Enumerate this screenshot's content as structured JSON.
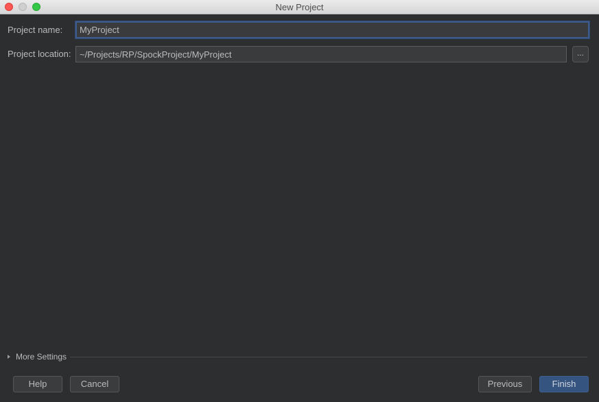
{
  "window": {
    "title": "New Project"
  },
  "form": {
    "project_name": {
      "label": "Project name:",
      "value": "MyProject"
    },
    "project_location": {
      "label": "Project location:",
      "value": "~/Projects/RP/SpockProject/MyProject",
      "browse_label": "..."
    }
  },
  "more_settings": {
    "label": "More Settings",
    "expanded": false
  },
  "buttons": {
    "help": "Help",
    "cancel": "Cancel",
    "previous": "Previous",
    "finish": "Finish"
  },
  "colors": {
    "accent": "#365480",
    "focus_border": "#3d5c8b",
    "background": "#2d2e30"
  }
}
